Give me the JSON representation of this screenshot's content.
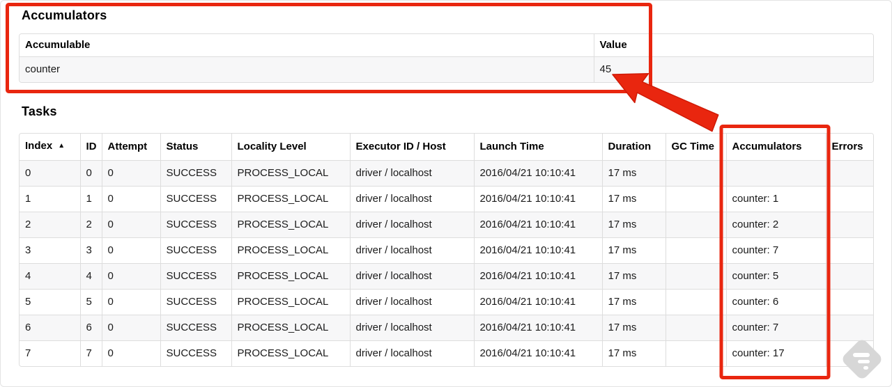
{
  "annotation": {
    "color": "#e9260f",
    "color_dark": "#cf1a06",
    "watermark_color": "#d7d7d7"
  },
  "accumulators_section": {
    "title": "Accumulators",
    "table": {
      "headers": [
        "Accumulable",
        "Value"
      ],
      "rows": [
        [
          "counter",
          "45"
        ]
      ]
    }
  },
  "tasks_section": {
    "title": "Tasks",
    "table": {
      "sort_indicator": "▲",
      "headers": [
        "Index",
        "ID",
        "Attempt",
        "Status",
        "Locality Level",
        "Executor ID / Host",
        "Launch Time",
        "Duration",
        "GC Time",
        "Accumulators",
        "Errors"
      ],
      "rows": [
        [
          "0",
          "0",
          "0",
          "SUCCESS",
          "PROCESS_LOCAL",
          "driver / localhost",
          "2016/04/21 10:10:41",
          "17 ms",
          "",
          "",
          ""
        ],
        [
          "1",
          "1",
          "0",
          "SUCCESS",
          "PROCESS_LOCAL",
          "driver / localhost",
          "2016/04/21 10:10:41",
          "17 ms",
          "",
          "counter: 1",
          ""
        ],
        [
          "2",
          "2",
          "0",
          "SUCCESS",
          "PROCESS_LOCAL",
          "driver / localhost",
          "2016/04/21 10:10:41",
          "17 ms",
          "",
          "counter: 2",
          ""
        ],
        [
          "3",
          "3",
          "0",
          "SUCCESS",
          "PROCESS_LOCAL",
          "driver / localhost",
          "2016/04/21 10:10:41",
          "17 ms",
          "",
          "counter: 7",
          ""
        ],
        [
          "4",
          "4",
          "0",
          "SUCCESS",
          "PROCESS_LOCAL",
          "driver / localhost",
          "2016/04/21 10:10:41",
          "17 ms",
          "",
          "counter: 5",
          ""
        ],
        [
          "5",
          "5",
          "0",
          "SUCCESS",
          "PROCESS_LOCAL",
          "driver / localhost",
          "2016/04/21 10:10:41",
          "17 ms",
          "",
          "counter: 6",
          ""
        ],
        [
          "6",
          "6",
          "0",
          "SUCCESS",
          "PROCESS_LOCAL",
          "driver / localhost",
          "2016/04/21 10:10:41",
          "17 ms",
          "",
          "counter: 7",
          ""
        ],
        [
          "7",
          "7",
          "0",
          "SUCCESS",
          "PROCESS_LOCAL",
          "driver / localhost",
          "2016/04/21 10:10:41",
          "17 ms",
          "",
          "counter: 17",
          ""
        ]
      ]
    }
  }
}
